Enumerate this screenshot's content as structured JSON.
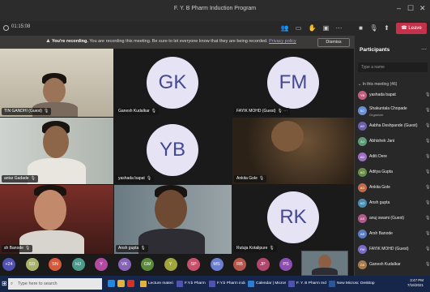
{
  "window": {
    "title": "F. Y. B Pharm Induction Program"
  },
  "toolbar": {
    "timer": "01:15:08",
    "leave_label": "Leave"
  },
  "banner": {
    "bold": "You're recording.",
    "text": " You are recording this meeting. Be sure to let everyone know that they are being recorded.",
    "link": "Privacy policy",
    "dismiss": "Dismiss"
  },
  "tiles": [
    {
      "label": "TIN GANDHI (Guest)"
    },
    {
      "label": "Ganesh Kudalkar",
      "initials": "GK"
    },
    {
      "label": "FAYIK MOHD (Guest)",
      "initials": "FM"
    },
    {
      "label": "antar Gadade"
    },
    {
      "label": "yashada bapat",
      "initials": "YB"
    },
    {
      "label": "Ankita Gole"
    },
    {
      "label": "sh Banode"
    },
    {
      "label": "Ansh gupta"
    },
    {
      "label": "Rutuja Kotalipure",
      "initials": "RK"
    }
  ],
  "bottom_avatars": [
    "+24",
    "SD",
    "SN",
    "HJ",
    "Y",
    "VK",
    "GM",
    "Y",
    "SP",
    "MS",
    "RB",
    "JP",
    "PS"
  ],
  "bottom_avatar_colors": [
    "#4f52b2",
    "#a8b26b",
    "#d45a3a",
    "#4d9a8b",
    "#b24ba0",
    "#8764b8",
    "#5c8a3c",
    "#a0a63c",
    "#c7506b",
    "#6b7fd1",
    "#b3564b",
    "#b1466e",
    "#8c4fb0"
  ],
  "panel": {
    "title": "Participants",
    "search_placeholder": "Type a name",
    "section": "In this meeting (46)",
    "participants": [
      {
        "initials": "YB",
        "name": "yashada bapat",
        "role": "",
        "color": "#c15f82"
      },
      {
        "initials": "SC",
        "name": "Shakuntala Chopade",
        "role": "Organizer",
        "color": "#6b8fd1"
      },
      {
        "initials": "AD",
        "name": "Aabha Deshpande (Guest)",
        "role": "",
        "color": "#6b5eaa"
      },
      {
        "initials": "AJ",
        "name": "Abhishek Jani",
        "role": "",
        "color": "#5e9a78"
      },
      {
        "initials": "AD",
        "name": "Aditi Dere",
        "role": "",
        "color": "#9a6fc1"
      },
      {
        "initials": "AG",
        "name": "Aditya Gupta",
        "role": "",
        "color": "#6a8c4b"
      },
      {
        "initials": "AG",
        "name": "Ankita Gole",
        "role": "",
        "color": "#c06a4b"
      },
      {
        "initials": "AG",
        "name": "Ansh gupta",
        "role": "",
        "color": "#4e8db0"
      },
      {
        "initials": "AS",
        "name": "anuj swami (Guest)",
        "role": "",
        "color": "#b05a8c"
      },
      {
        "initials": "AB",
        "name": "Arsh Banode",
        "role": "",
        "color": "#5c7cbf"
      },
      {
        "initials": "FM",
        "name": "FAYIK MOHD (Guest)",
        "role": "",
        "color": "#7a6bc4"
      },
      {
        "initials": "GK",
        "name": "Ganesh Kudalkar",
        "role": "",
        "color": "#a67b4c"
      }
    ]
  },
  "taskbar": {
    "search_placeholder": "Type here to search",
    "apps": [
      "Lecture material",
      "F.Y.b Pharm induct...",
      "F.Y.b Pharm induct...",
      "Calendar | Microsof...",
      "F. Y. B Pharm Induction Prog...",
      "New Microsoft Wor..."
    ],
    "desktop": "Desktop",
    "time": "3:47 PM",
    "date": "7/16/2021"
  }
}
